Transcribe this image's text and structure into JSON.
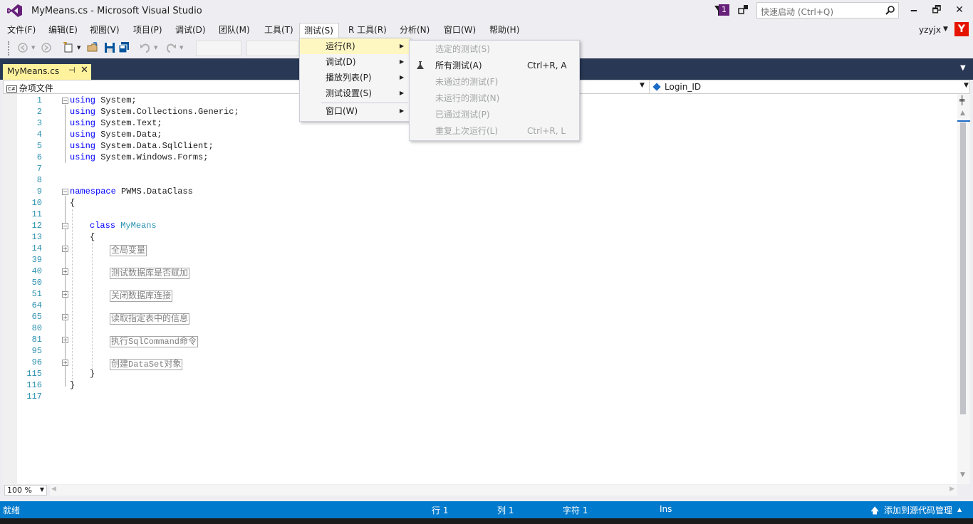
{
  "window": {
    "title": "MyMeans.cs - Microsoft Visual Studio",
    "notification_count": "1",
    "quick_launch_placeholder": "快速启动 (Ctrl+Q)",
    "minimize": "🗕",
    "restore": "🗗",
    "close": "✕"
  },
  "menu": [
    "文件(F)",
    "编辑(E)",
    "视图(V)",
    "项目(P)",
    "调试(D)",
    "团队(M)",
    "工具(T)",
    "测试(S)",
    "R 工具(R)",
    "分析(N)",
    "窗口(W)",
    "帮助(H)"
  ],
  "user": {
    "name": "yzyjx",
    "avatar_letter": "Y"
  },
  "tab": {
    "label": "MyMeans.cs",
    "pin": "⊣",
    "close": "✕"
  },
  "navbar": {
    "project": "杂项文件",
    "project_icon": "C#",
    "member": "Login_ID"
  },
  "code": {
    "line_numbers": [
      "1",
      "2",
      "3",
      "4",
      "5",
      "6",
      "7",
      "8",
      "9",
      "10",
      "11",
      "12",
      "13",
      "14",
      "39",
      "40",
      "50",
      "51",
      "64",
      "65",
      "80",
      "81",
      "95",
      "96",
      "115",
      "116",
      "117"
    ],
    "usings": [
      {
        "kw": "using",
        "ns": " System;"
      },
      {
        "kw": "using",
        "ns": " System.Collections.Generic;"
      },
      {
        "kw": "using",
        "ns": " System.Text;"
      },
      {
        "kw": "using",
        "ns": " System.Data;"
      },
      {
        "kw": "using",
        "ns": " System.Data.SqlClient;"
      },
      {
        "kw": "using",
        "ns": " System.Windows.Forms;"
      }
    ],
    "namespace_kw": "namespace",
    "namespace_name": " PWMS.DataClass",
    "open_brace": "{",
    "close_brace": "}",
    "class_kw": "class",
    "class_name": "MyMeans",
    "regions": [
      "全局变量",
      "测试数据库是否赋加",
      "关闭数据库连接",
      "读取指定表中的信息",
      "执行SqlCommand命令",
      "创建DataSet对象"
    ]
  },
  "zoom": "100 %",
  "status": {
    "ready": "就绪",
    "row": "行 1",
    "col": "列 1",
    "char": "字符 1",
    "ins": "Ins",
    "source_control": "添加到源代码管理"
  },
  "test_menu": {
    "items": [
      {
        "label": "运行(R)",
        "submenu": true
      },
      {
        "label": "调试(D)",
        "submenu": true
      },
      {
        "label": "播放列表(P)",
        "submenu": true
      },
      {
        "label": "测试设置(S)",
        "submenu": true
      },
      {
        "label": "窗口(W)",
        "submenu": true
      }
    ]
  },
  "run_submenu": {
    "items": [
      {
        "label": "选定的测试(S)",
        "shortcut": "",
        "enabled": false
      },
      {
        "label": "所有测试(A)",
        "shortcut": "Ctrl+R, A",
        "enabled": true
      },
      {
        "label": "未通过的测试(F)",
        "shortcut": "",
        "enabled": false
      },
      {
        "label": "未运行的测试(N)",
        "shortcut": "",
        "enabled": false
      },
      {
        "label": "已通过测试(P)",
        "shortcut": "",
        "enabled": false
      },
      {
        "label": "重复上次运行(L)",
        "shortcut": "Ctrl+R, L",
        "enabled": false
      }
    ]
  },
  "colors": {
    "accent": "#007acc",
    "tab_active": "#fff29d",
    "dark_band": "#293955",
    "keyword": "#0000ff",
    "type": "#2b91af",
    "line_number": "#2b91af"
  }
}
